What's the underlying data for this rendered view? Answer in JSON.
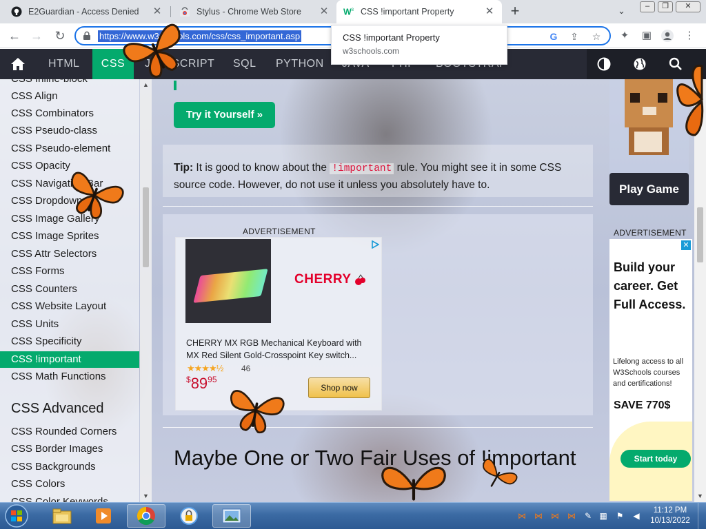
{
  "browser": {
    "tabs": [
      {
        "title": "E2Guardian - Access Denied",
        "favicon": "github-icon"
      },
      {
        "title": "Stylus - Chrome Web Store",
        "favicon": "chrome-webstore-icon"
      },
      {
        "title": "CSS !important Property",
        "favicon": "w3schools-icon"
      }
    ],
    "new_tab_label": "+",
    "url": "https://www.w3schools.com/css/css_important.asp",
    "tooltip": {
      "title": "CSS !important Property",
      "domain": "w3schools.com"
    }
  },
  "topnav": {
    "items": [
      "HTML",
      "CSS",
      "JAVASCRIPT",
      "SQL",
      "PYTHON",
      "JAVA",
      "PHP",
      "BOOTSTRAP"
    ],
    "active": "CSS"
  },
  "sidebar": {
    "items": [
      "CSS Inline-block",
      "CSS Align",
      "CSS Combinators",
      "CSS Pseudo-class",
      "CSS Pseudo-element",
      "CSS Opacity",
      "CSS Navigation Bar",
      "CSS Dropdowns",
      "CSS Image Gallery",
      "CSS Image Sprites",
      "CSS Attr Selectors",
      "CSS Forms",
      "CSS Counters",
      "CSS Website Layout",
      "CSS Units",
      "CSS Specificity",
      "CSS !important",
      "CSS Math Functions"
    ],
    "active": "CSS !important",
    "advanced_heading": "CSS Advanced",
    "advanced_items": [
      "CSS Rounded Corners",
      "CSS Border Images",
      "CSS Backgrounds",
      "CSS Colors",
      "CSS Color Keywords"
    ]
  },
  "main": {
    "try_button": "Try it Yourself »",
    "tip": {
      "label": "Tip:",
      "before": " It is good to know about the ",
      "code": "!important",
      "after": " rule. You might see it in some CSS source code. However, do not use it unless you absolutely have to."
    },
    "ad_label": "ADVERTISEMENT",
    "ad": {
      "brand": "CHERRY",
      "title": "CHERRY MX RGB Mechanical Keyboard with MX Red Silent Gold-Crosspoint Key switch...",
      "rating_stars": "★★★★½",
      "rating_count": "46",
      "price_currency": "$",
      "price_whole": "89",
      "price_cents": "95",
      "button": "Shop now"
    },
    "heading": "Maybe One or Two Fair Uses of !important"
  },
  "right": {
    "play_button": "Play Game",
    "ad_label": "ADVERTISEMENT",
    "ad": {
      "headline": "Build your career. Get Full Access.",
      "body": "Lifelong access to all W3Schools courses and certifications!",
      "save": "SAVE 770$",
      "button": "Start today",
      "close": "✕"
    }
  },
  "taskbar": {
    "time": "11:12 PM",
    "date": "10/13/2022"
  },
  "colors": {
    "accent": "#04aa6d",
    "nav_dark": "#282a35",
    "chrome_focus": "#1a73e8"
  }
}
